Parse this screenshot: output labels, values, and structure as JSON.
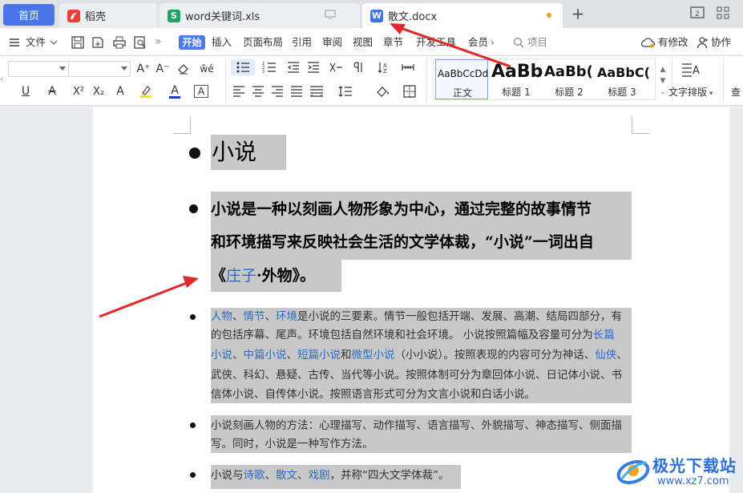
{
  "tabs": {
    "home": "首页",
    "daoke": "稻壳",
    "xls": "word关键词.xls",
    "doc": "散文.docx"
  },
  "menu": {
    "file": "文件",
    "start": "开始",
    "insert": "插入",
    "layout": "页面布局",
    "reference": "引用",
    "review": "审阅",
    "view": "视图",
    "chapter": "章节",
    "devtools": "开发工具",
    "member": "会员",
    "search": "项目",
    "changes": "有修改",
    "collab": "协作"
  },
  "styles": {
    "normal_sample": "AaBbCcDd",
    "normal_name": "正文",
    "h1_sample": "AaBb",
    "h1_name": "标题 1",
    "h2_sample": "AaBb(",
    "h2_name": "标题 2",
    "h3_sample": "AaBbC(",
    "h3_name": "标题 3",
    "text_layout": "文字排版",
    "find": "查"
  },
  "document": {
    "title": "小说",
    "para_bold_1": "小说是一种以刻画人物形象为中心，通过完整的故事情节",
    "para_bold_2": "和环境描写来反映社会生活的文学体裁，“小说”一词出自",
    "para_bold_3_a": "《",
    "para_bold_3_link": "庄子",
    "para_bold_3_b": "·外物》。",
    "b1_l1_k1": "人物",
    "b1_l1_s1": "、",
    "b1_l1_k2": "情节",
    "b1_l1_s2": "、",
    "b1_l1_k3": "环境",
    "b1_l1_rest": "是小说的三要素。情节一般包括开端、发展、高潮、结局四部分，有",
    "b1_l2_a": "的包括序幕、尾声。环境包括自然环境和社会环境。 小说按照篇幅及容量可分为",
    "b1_l2_k": "长篇",
    "b1_l3_k1": "小说",
    "b1_l3_s1": "、",
    "b1_l3_k2": "中篇小说",
    "b1_l3_s2": "、",
    "b1_l3_k3": "短篇小说",
    "b1_l3_s3": "和",
    "b1_l3_k4": "微型小说",
    "b1_l3_rest": "（小小说）。按照表现的内容可分为神话、",
    "b1_l3_k5": "仙侠",
    "b1_l3_end": "、",
    "b1_l4": "武侠、科幻、悬疑、古传、当代等小说。按照体制可分为章回体小说、日记体小说、书",
    "b1_l5": "信体小说、自传体小说。按照语言形式可分为文言小说和白话小说。",
    "b2_l1": "小说刻画人物的方法：心理描写、动作描写、语言描写、外貌描写、神态描写、侧面描",
    "b2_l2": "写。同时，小说是一种写作方法。",
    "b3_a": "小说与",
    "b3_k1": "诗歌",
    "b3_s1": "、",
    "b3_k2": "散文",
    "b3_s2": "、",
    "b3_k3": "戏剧",
    "b3_rest": "，并称“四大文学体裁”。"
  },
  "watermark": {
    "name": "极光下载站",
    "url": "www.xz7.com"
  },
  "colors": {
    "accent": "#4b7bec",
    "selection": "#c8c8c8",
    "link": "#2b6cc4",
    "arrow": "#e0282d"
  }
}
